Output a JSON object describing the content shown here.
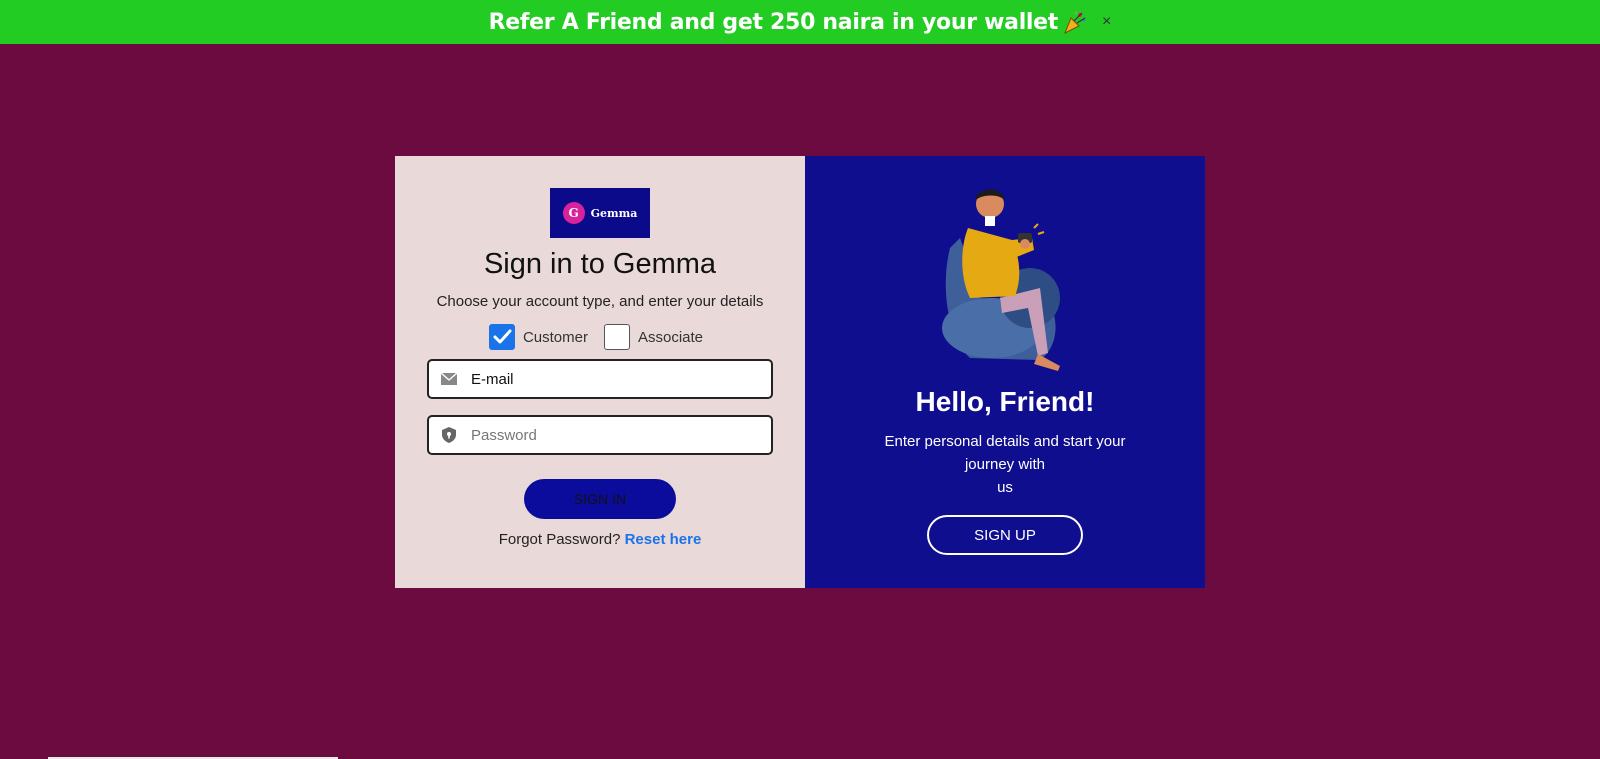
{
  "banner": {
    "text": "Refer A Friend and get 250 naira in your wallet",
    "emoji_icon": "party-popper-icon",
    "close_label": "×"
  },
  "login": {
    "logo_text": "Gemma",
    "logo_mark": "G",
    "title": "Sign in to Gemma",
    "subtitle": "Choose your account type, and enter your details",
    "account_types": [
      {
        "label": "Customer",
        "checked": true
      },
      {
        "label": "Associate",
        "checked": false
      }
    ],
    "email_placeholder": "E-mail",
    "password_placeholder": "Password",
    "signin_label": "SIGN IN",
    "forgot_text": "Forgot Password?",
    "reset_link": "Reset here"
  },
  "welcome": {
    "heading": "Hello, Friend!",
    "text_line1": "Enter personal details and start your journey with",
    "text_line2": "us",
    "signup_label": "SIGN UP"
  },
  "colors": {
    "page_bg": "#6b0b3f",
    "banner_bg": "#22cc22",
    "left_panel_bg": "#ead9d9",
    "right_panel_bg": "#0e0e8e",
    "accent_blue": "#1a73e8"
  }
}
